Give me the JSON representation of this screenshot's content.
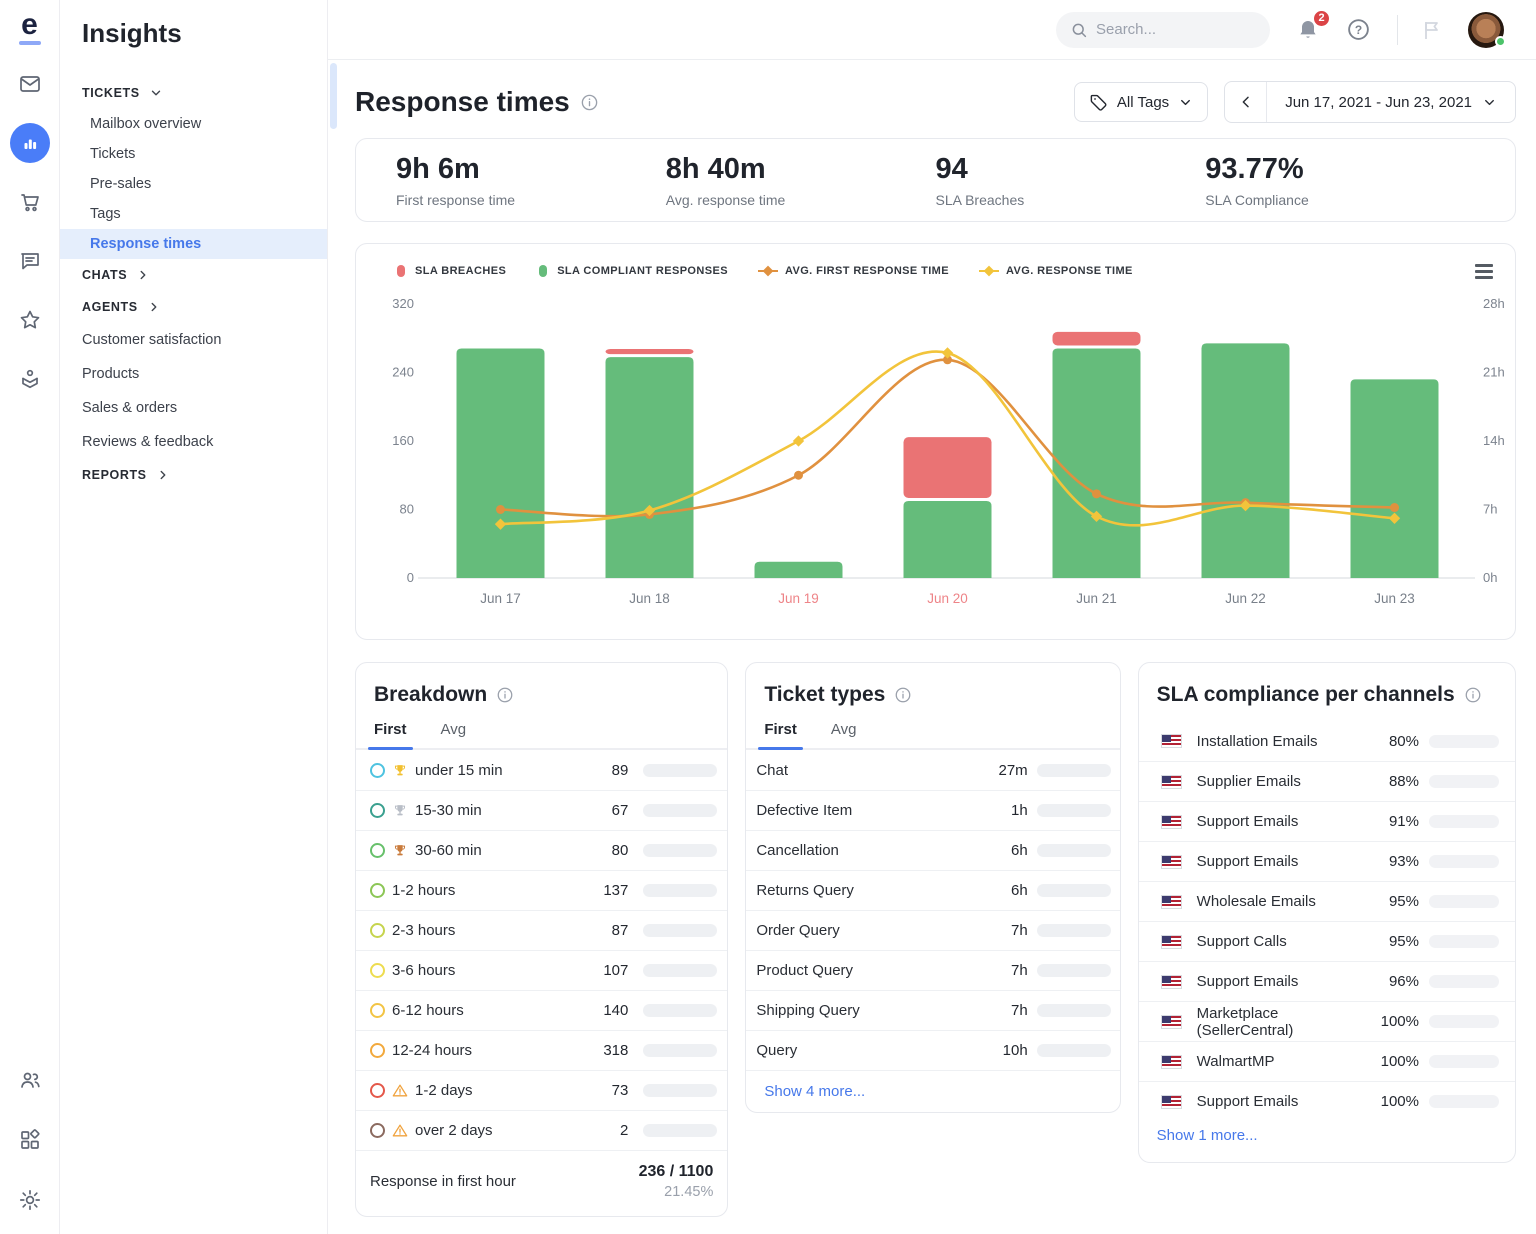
{
  "brand": {
    "logo_letter": "e"
  },
  "rail": {
    "icons": [
      "mail-icon",
      "analytics-icon",
      "cart-icon",
      "chat-icon",
      "star-icon",
      "product-box-icon"
    ],
    "bottom_icons": [
      "users-icon",
      "apps-icon",
      "settings-icon"
    ],
    "active_icon": "analytics-icon"
  },
  "sidebar": {
    "title": "Insights",
    "sections": [
      {
        "type": "section",
        "label": "TICKETS",
        "chevron": "down",
        "items": [
          "Mailbox overview",
          "Tickets",
          "Pre-sales",
          "Tags",
          "Response times"
        ],
        "active_item": "Response times"
      },
      {
        "type": "section",
        "label": "CHATS",
        "chevron": "right",
        "items": []
      },
      {
        "type": "section",
        "label": "AGENTS",
        "chevron": "right",
        "items": []
      },
      {
        "type": "link",
        "label": "Customer satisfaction"
      },
      {
        "type": "link",
        "label": "Products"
      },
      {
        "type": "link",
        "label": "Sales & orders"
      },
      {
        "type": "link",
        "label": "Reviews & feedback"
      },
      {
        "type": "section",
        "label": "REPORTS",
        "chevron": "right",
        "items": []
      }
    ]
  },
  "topbar": {
    "search_placeholder": "Search...",
    "notification_count": "2"
  },
  "header": {
    "title": "Response times",
    "all_tags_label": "All Tags",
    "date_range": "Jun 17, 2021 - Jun 23, 2021"
  },
  "stats": [
    {
      "value": "9h 6m",
      "label": "First response time"
    },
    {
      "value": "8h 40m",
      "label": "Avg. response time"
    },
    {
      "value": "94",
      "label": "SLA Breaches"
    },
    {
      "value": "93.77%",
      "label": "SLA Compliance"
    }
  ],
  "chart_data": {
    "type": "bar",
    "subtype": "stacked bars with smoothed hour lines",
    "categories": [
      "Jun 17",
      "Jun 18",
      "Jun 19",
      "Jun 20",
      "Jun 21",
      "Jun 22",
      "Jun 23"
    ],
    "weekend_flags": [
      false,
      false,
      true,
      true,
      false,
      false,
      false
    ],
    "series": [
      {
        "name": "SLA Compliant Responses",
        "type": "bar",
        "color": "#65BC7B",
        "values": [
          268,
          258,
          19,
          90,
          268,
          274,
          232
        ]
      },
      {
        "name": "SLA Breaches",
        "type": "bar",
        "color": "#EA7374",
        "values": [
          0,
          6,
          0,
          71,
          16,
          0,
          0
        ]
      },
      {
        "name": "Avg. First Response Time",
        "type": "line",
        "color": "#E0913F",
        "unit": "hours",
        "values": [
          7,
          6.5,
          10.5,
          22.3,
          8.6,
          7.7,
          7.2
        ]
      },
      {
        "name": "Avg. Response Time",
        "type": "line",
        "color": "#F2C43B",
        "unit": "hours",
        "values": [
          5.5,
          6.9,
          14,
          23,
          6.3,
          7.4,
          6.1
        ]
      }
    ],
    "left_axis": {
      "min": 0,
      "max": 320,
      "ticks": [
        0,
        80,
        160,
        240,
        320
      ]
    },
    "right_axis": {
      "min": 0,
      "max": 28,
      "tick_labels": [
        "0h",
        "7h",
        "14h",
        "21h",
        "28h"
      ]
    },
    "grid": false,
    "legend_position": "top",
    "legend": [
      {
        "label": "SLA BREACHES",
        "marker": "pill",
        "color": "#EA7374"
      },
      {
        "label": "SLA COMPLIANT RESPONSES",
        "marker": "pill",
        "color": "#65BC7B"
      },
      {
        "label": "AVG. FIRST RESPONSE TIME",
        "marker": "diamond",
        "color": "#E0913F"
      },
      {
        "label": "AVG. RESPONSE TIME",
        "marker": "diamond",
        "color": "#F2C43B"
      }
    ]
  },
  "breakdown": {
    "title": "Breakdown",
    "tabs": [
      "First",
      "Avg"
    ],
    "active_tab": "First",
    "bar_max": 318,
    "rows": [
      {
        "ring": "#4EC3E0",
        "badge": "trophy-gold",
        "label": "under 15 min",
        "value": 89
      },
      {
        "ring": "#3AA08F",
        "badge": "trophy-silver",
        "label": "15-30 min",
        "value": 67
      },
      {
        "ring": "#67C06B",
        "badge": "trophy-bronze",
        "label": "30-60 min",
        "value": 80
      },
      {
        "ring": "#8CC656",
        "badge": null,
        "label": "1-2 hours",
        "value": 137
      },
      {
        "ring": "#C6D44D",
        "badge": null,
        "label": "2-3 hours",
        "value": 87
      },
      {
        "ring": "#EDDC4F",
        "badge": null,
        "label": "3-6 hours",
        "value": 107
      },
      {
        "ring": "#F2C444",
        "badge": null,
        "label": "6-12 hours",
        "value": 140
      },
      {
        "ring": "#F2A93C",
        "badge": null,
        "label": "12-24 hours",
        "value": 318
      },
      {
        "ring": "#E4584A",
        "badge": "warning",
        "label": "1-2 days",
        "value": 73
      },
      {
        "ring": "#8B6A5F",
        "badge": "warning",
        "label": "over 2 days",
        "value": 2
      }
    ],
    "footer": {
      "label": "Response in first hour",
      "value": "236 / 1100",
      "percent": "21.45%"
    }
  },
  "ticket_types": {
    "title": "Ticket types",
    "tabs": [
      "First",
      "Avg"
    ],
    "active_tab": "First",
    "bar_max_minutes": 840,
    "rows": [
      {
        "label": "Chat",
        "value": "27m",
        "minutes": 27
      },
      {
        "label": "Defective Item",
        "value": "1h",
        "minutes": 60
      },
      {
        "label": "Cancellation",
        "value": "6h",
        "minutes": 360
      },
      {
        "label": "Returns Query",
        "value": "6h",
        "minutes": 360
      },
      {
        "label": "Order Query",
        "value": "7h",
        "minutes": 420
      },
      {
        "label": "Product Query",
        "value": "7h",
        "minutes": 420
      },
      {
        "label": "Shipping Query",
        "value": "7h",
        "minutes": 420
      },
      {
        "label": "Query",
        "value": "10h",
        "minutes": 600
      }
    ],
    "show_more": "Show 4 more..."
  },
  "sla_channels": {
    "title": "SLA compliance per channels",
    "green_threshold": 93,
    "rows": [
      {
        "label": "Installation Emails",
        "percent": 80
      },
      {
        "label": "Supplier Emails",
        "percent": 88
      },
      {
        "label": "Support Emails",
        "percent": 91
      },
      {
        "label": "Support Emails",
        "percent": 93
      },
      {
        "label": "Wholesale Emails",
        "percent": 95
      },
      {
        "label": "Support Calls",
        "percent": 95
      },
      {
        "label": "Support Emails",
        "percent": 96
      },
      {
        "label": "Marketplace (SellerCentral)",
        "percent": 100
      },
      {
        "label": "WalmartMP",
        "percent": 100
      },
      {
        "label": "Support Emails",
        "percent": 100
      }
    ],
    "show_more": "Show 1 more..."
  },
  "colors": {
    "accent_blue": "#4678EA",
    "progress_blue": "#4D79F1",
    "bar_green": "#65BC7B",
    "bar_red": "#EA7374",
    "line_orange": "#E0913F",
    "line_yellow": "#F2C43B",
    "sla_green": "#72C383",
    "sla_orange": "#E9994D",
    "weekend_label": "#EE8488",
    "axis_label": "#7C838E",
    "badge_red": "#DB4446",
    "trophy_gold": "#F2C030",
    "trophy_silver": "#B9BEC7",
    "trophy_bronze": "#C97B3C",
    "warning_orange": "#F0A33F"
  }
}
